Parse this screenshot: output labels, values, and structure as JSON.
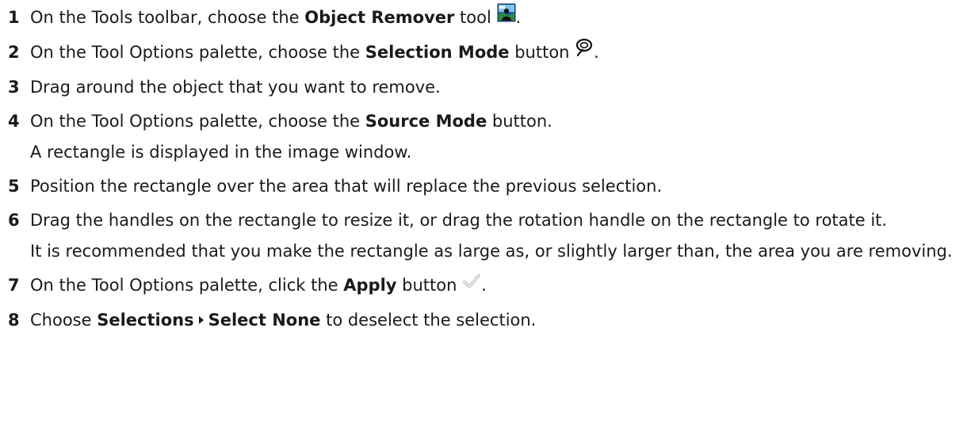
{
  "steps": [
    {
      "num": "1",
      "pre": "On the Tools toolbar, choose the ",
      "bold": "Object Remover",
      "post": " tool",
      "end": ".",
      "icon": "object-remover-icon"
    },
    {
      "num": "2",
      "pre": "On the Tool Options palette, choose the ",
      "bold": "Selection Mode",
      "post": " button",
      "end": ".",
      "icon": "lasso-selection-icon"
    },
    {
      "num": "3",
      "text": "Drag around the object that you want to remove."
    },
    {
      "num": "4",
      "pre": "On the Tool Options palette, choose the ",
      "bold": "Source Mode",
      "post": " button.",
      "note": "A rectangle is displayed in the image window."
    },
    {
      "num": "5",
      "text": "Position the rectangle over the area that will replace the previous selection."
    },
    {
      "num": "6",
      "text": "Drag the handles on the rectangle to resize it, or drag the rotation handle on the rectangle to rotate it.",
      "note": "It is recommended that you make the rectangle as large as, or slightly larger than, the area you are removing."
    },
    {
      "num": "7",
      "pre": "On the Tool Options palette, click the ",
      "bold": "Apply",
      "post": " button",
      "end": ".",
      "icon": "checkmark-icon"
    },
    {
      "num": "8",
      "pre": "Choose ",
      "bold": "Selections",
      "bold2": "Select None",
      "post": " to deselect the selection."
    }
  ]
}
